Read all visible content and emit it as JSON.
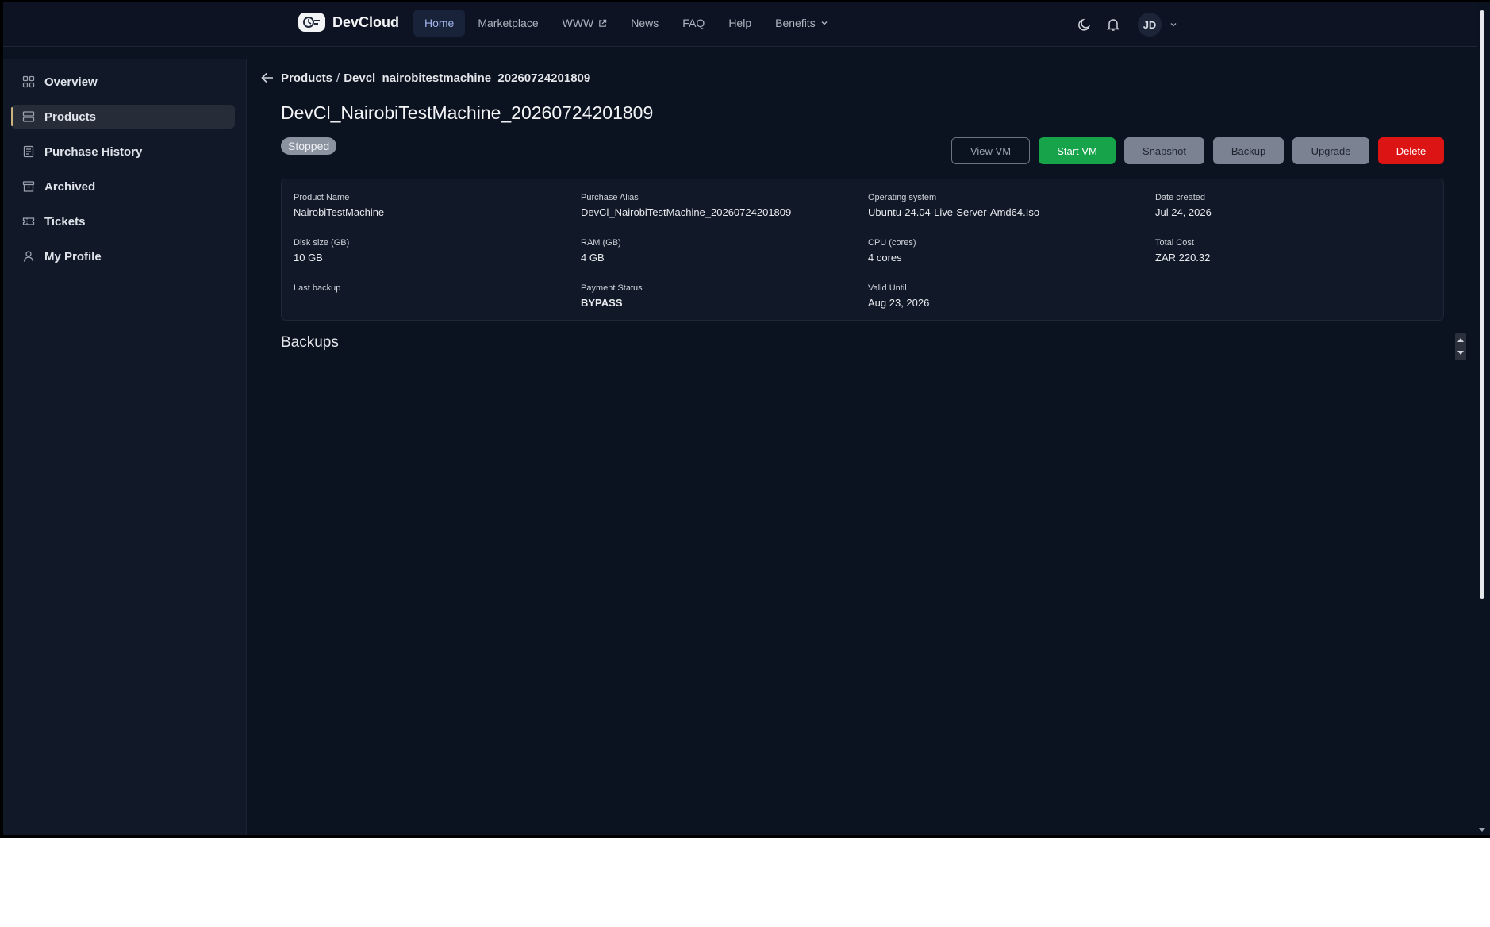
{
  "app": {
    "name": "DevCloud"
  },
  "nav": {
    "items": [
      {
        "label": "Home",
        "active": true
      },
      {
        "label": "Marketplace"
      },
      {
        "label": "WWW",
        "icon": "external-link-icon"
      },
      {
        "label": "News"
      },
      {
        "label": "FAQ"
      },
      {
        "label": "Help"
      },
      {
        "label": "Benefits",
        "icon": "chevron-down-icon"
      }
    ]
  },
  "header": {
    "user_initials": "JD",
    "icons": [
      "moon-icon",
      "bell-icon",
      "chevron-down-icon"
    ]
  },
  "sidebar": {
    "items": [
      {
        "label": "Overview",
        "icon": "grid-icon"
      },
      {
        "label": "Products",
        "icon": "server-icon",
        "active": true
      },
      {
        "label": "Purchase History",
        "icon": "receipt-icon"
      },
      {
        "label": "Archived",
        "icon": "archive-icon"
      },
      {
        "label": "Tickets",
        "icon": "ticket-icon"
      },
      {
        "label": "My Profile",
        "icon": "user-icon"
      }
    ]
  },
  "breadcrumb": {
    "parent": "Products",
    "separator": "/",
    "current": "Devcl_nairobitestmachine_20260724201809"
  },
  "product": {
    "title": "DevCl_NairobiTestMachine_20260724201809",
    "status": "Stopped"
  },
  "actions": {
    "view_vm": "View VM",
    "start_vm": "Start VM",
    "snapshot": "Snapshot",
    "backup": "Backup",
    "upgrade": "Upgrade",
    "delete": "Delete"
  },
  "details": {
    "product_name": {
      "label": "Product Name",
      "value": "NairobiTestMachine"
    },
    "purchase_alias": {
      "label": "Purchase Alias",
      "value": "DevCl_NairobiTestMachine_20260724201809"
    },
    "operating_system": {
      "label": "Operating system",
      "value": "Ubuntu-24.04-Live-Server-Amd64.Iso"
    },
    "date_created": {
      "label": "Date created",
      "value": "Jul 24, 2026"
    },
    "disk_size": {
      "label": "Disk size (GB)",
      "value": "10 GB"
    },
    "ram": {
      "label": "RAM (GB)",
      "value": "4 GB"
    },
    "cpu": {
      "label": "CPU (cores)",
      "value": "4 cores"
    },
    "total_cost": {
      "label": "Total Cost",
      "value": "ZAR 220.32"
    },
    "last_backup": {
      "label": "Last backup",
      "value": ""
    },
    "payment_status": {
      "label": "Payment Status",
      "value": "BYPASS"
    },
    "valid_until": {
      "label": "Valid Until",
      "value": "Aug 23, 2026"
    }
  },
  "backups": {
    "title": "Backups"
  },
  "colors": {
    "background": "#0b1220",
    "sidebar": "#111827",
    "start_green": "#16a34a",
    "delete_red": "#dc1414",
    "secondary_gray": "#7b8291",
    "active_accent": "#c9b27c"
  }
}
